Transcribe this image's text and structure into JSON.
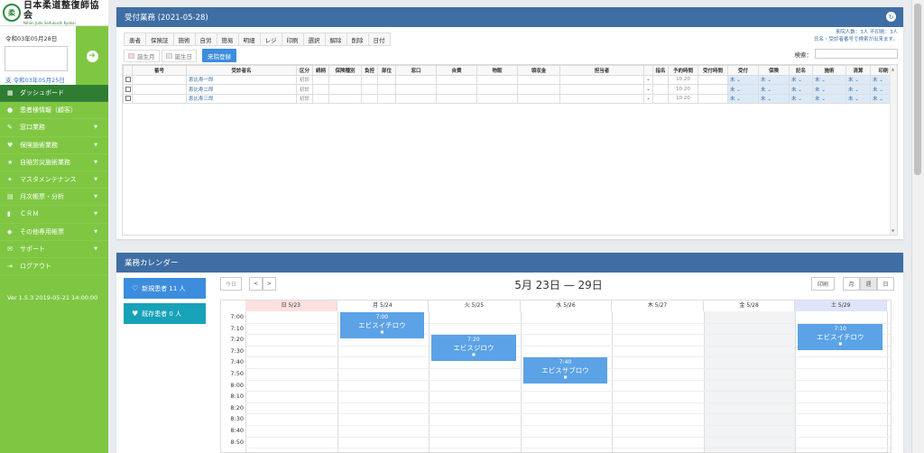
{
  "sidebar": {
    "logo_main": "日本柔道整復師協会",
    "logo_sub": "Nihon Judo Seifukushi Kyokai",
    "logo_mark": "柔",
    "top_date": "令和03年05月28日",
    "sub_date": "支 令和03年05月25日",
    "items": [
      {
        "label": "ダッシュボード",
        "icon": "▦",
        "caret": false,
        "active": true
      },
      {
        "label": "患者様情報（顧客）",
        "icon": "●",
        "caret": false
      },
      {
        "label": "窓口業務",
        "icon": "✎",
        "caret": true
      },
      {
        "label": "保険施術業務",
        "icon": "♥",
        "caret": true
      },
      {
        "label": "自賠労災施術業務",
        "icon": "★",
        "caret": true
      },
      {
        "label": "マスタメンテナンス",
        "icon": "✦",
        "caret": true
      },
      {
        "label": "月次帳票・分析",
        "icon": "▤",
        "caret": true
      },
      {
        "label": "ＣＲＭ",
        "icon": "▮",
        "caret": true
      },
      {
        "label": "その他専用帳票",
        "icon": "◆",
        "caret": true
      },
      {
        "label": "サポート",
        "icon": "✉",
        "caret": true
      },
      {
        "label": "ログアウト",
        "icon": "⇥",
        "caret": false
      }
    ],
    "version": "Ver 1.5.3 2019-05-21 14:00:00"
  },
  "reception": {
    "title": "受付業務 (2021-05-28)",
    "tabs": [
      "患者",
      "保険証",
      "施術",
      "自労",
      "簡易",
      "明細",
      "レジ",
      "印刷",
      "選択",
      "解除",
      "削除",
      "日付"
    ],
    "filter_birth_month": "誕生月",
    "filter_birth_day": "誕生日",
    "register_button": "来院登録",
    "info_line1": "来院人数：3人 不印刷：3人",
    "info_line2": "氏名・受診者番号で検索が出来ます。",
    "search_label": "検索：",
    "columns": [
      "番号",
      "受診者名",
      "区分",
      "続柄",
      "保険種別",
      "負担",
      "部位",
      "窓口",
      "自費",
      "物販",
      "領収金",
      "担当者",
      "",
      "指名",
      "予約時間",
      "受付時間",
      "受付",
      "保険",
      "記名",
      "施術",
      "清算",
      "印刷"
    ],
    "rows": [
      {
        "name": "恵比寿一郎",
        "kubun": "初診",
        "yoyaku": "10:20",
        "uketsuke_status": "未",
        "hoken": "未",
        "kimei": "未",
        "sejutsu": "未",
        "seisan": "未",
        "insatsu": "未"
      },
      {
        "name": "恵比寿二郎",
        "kubun": "初診",
        "yoyaku": "10:20",
        "uketsuke_status": "未",
        "hoken": "未",
        "kimei": "未",
        "sejutsu": "未",
        "seisan": "未",
        "insatsu": "未"
      },
      {
        "name": "恵比寿三郎",
        "kubun": "初診",
        "yoyaku": "10:20",
        "uketsuke_status": "未",
        "hoken": "未",
        "kimei": "未",
        "sejutsu": "未",
        "seisan": "未",
        "insatsu": "未"
      }
    ]
  },
  "calendar": {
    "title": "業務カレンダー",
    "new_patient": "新規患者 11 人",
    "existing_patient": "既存患者 0 人",
    "today_button": "今日",
    "prev_button": "<",
    "next_button": ">",
    "range_title": "5月 23日 — 29日",
    "print_button": "印刷",
    "view_month": "月",
    "view_week": "週",
    "view_day": "日",
    "days": [
      "日 5/23",
      "月 5/24",
      "火 5/25",
      "水 5/26",
      "木 5/27",
      "金 5/28",
      "土 5/29"
    ],
    "times": [
      "7:00",
      "7:10",
      "7:20",
      "7:30",
      "7:40",
      "7:50",
      "8:00",
      "8:10",
      "8:20",
      "8:30",
      "8:40",
      "8:50"
    ],
    "events": [
      {
        "day": 1,
        "time": "7:00",
        "name": "エビスイチロウ"
      },
      {
        "day": 2,
        "time": "7:20",
        "name": "エビスジロウ"
      },
      {
        "day": 3,
        "time": "7:40",
        "name": "エビスサブロウ"
      },
      {
        "day": 6,
        "time": "7:10",
        "name": "エビスイチロウ"
      }
    ],
    "colors": {
      "sunday": "#fde0e0",
      "saturday": "#e0e4fb",
      "today": "#f1f3f4",
      "event": "#5ba2e6"
    }
  }
}
